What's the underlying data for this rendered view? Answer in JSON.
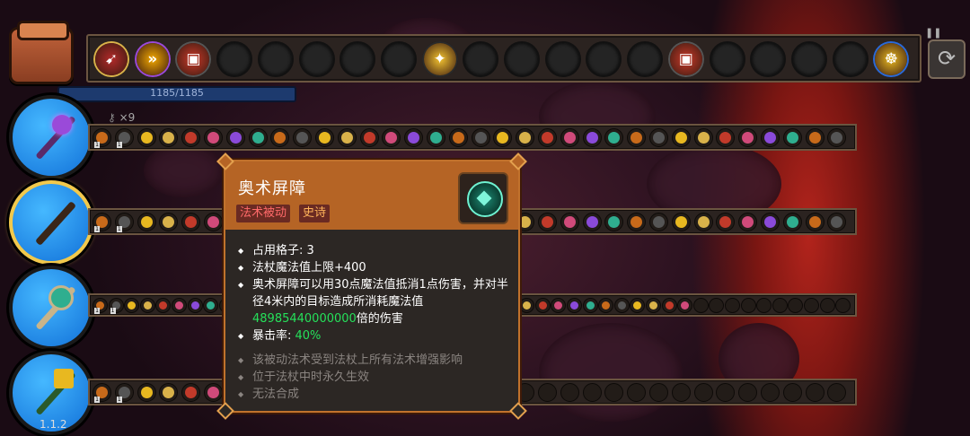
{
  "hud": {
    "mana_text": "1185/1185",
    "key_count": "×9",
    "version": "1.1.2"
  },
  "topbar_slots": [
    {
      "icon": "bow-spell-icon",
      "filled": true,
      "color": "#b22a2a",
      "ring": "#d9b24a"
    },
    {
      "icon": "speed-chevron-icon",
      "filled": true,
      "color": "#f2a800",
      "ring": "#9a4ad9"
    },
    {
      "icon": "red-chest-icon",
      "filled": true,
      "color": "#c83a2a",
      "ring": "#555"
    },
    {
      "icon": "",
      "filled": false
    },
    {
      "icon": "",
      "filled": false
    },
    {
      "icon": "",
      "filled": false
    },
    {
      "icon": "",
      "filled": false
    },
    {
      "icon": "",
      "filled": false
    },
    {
      "icon": "rune-icon",
      "filled": true,
      "color": "#f2c230",
      "ring": "#2a2a2a"
    },
    {
      "icon": "",
      "filled": false
    },
    {
      "icon": "",
      "filled": false
    },
    {
      "icon": "",
      "filled": false
    },
    {
      "icon": "",
      "filled": false
    },
    {
      "icon": "",
      "filled": false
    },
    {
      "icon": "red-chest-icon",
      "filled": true,
      "color": "#c83a2a",
      "ring": "#555"
    },
    {
      "icon": "",
      "filled": false
    },
    {
      "icon": "",
      "filled": false
    },
    {
      "icon": "",
      "filled": false
    },
    {
      "icon": "",
      "filled": false
    },
    {
      "icon": "gold-coin-icon",
      "filled": true,
      "color": "#e8b820",
      "ring": "#2a6ad9"
    }
  ],
  "tooltip": {
    "title": "奥术屏障",
    "tag_type": "法术被动",
    "tag_rarity": "史诗",
    "line1": "占用格子: 3",
    "line2": "法杖魔法值上限+400",
    "line3a": "奥术屏障可以用30点魔法值抵消1点伤害，并对半径4米内的目标造成所消耗魔法值",
    "line3_number": "48985440000000",
    "line3b": "倍的伤害",
    "crit_label": "暴击率: ",
    "crit_value": "40%",
    "note1": "该被动法术受到法杖上所有法术增强影响",
    "note2": "位于法杖中时永久生效",
    "note3": "无法合成"
  },
  "wands": [
    {
      "name": "purple-mace-wand",
      "selected": false
    },
    {
      "name": "dark-stick-wand",
      "selected": true
    },
    {
      "name": "teal-orb-wand",
      "selected": false
    },
    {
      "name": "golden-trident-wand",
      "selected": false
    }
  ]
}
